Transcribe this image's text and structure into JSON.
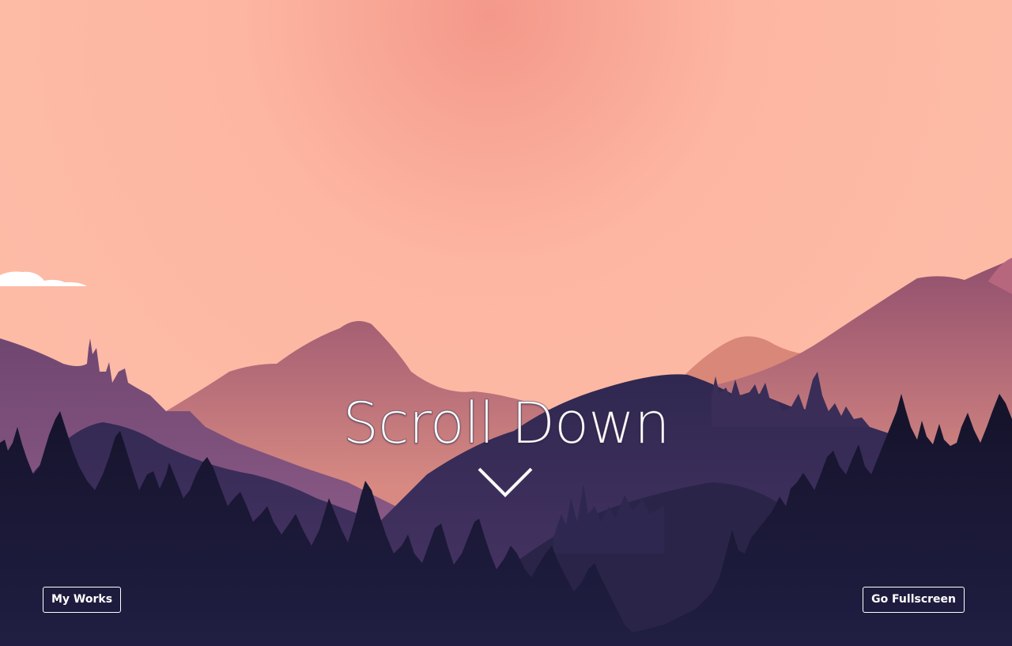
{
  "hero": {
    "title": "Scroll Down",
    "arrow_icon": "chevron-down-icon"
  },
  "buttons": {
    "my_works": "My Works",
    "fullscreen": "Go Fullscreen"
  },
  "colors": {
    "sky_top": "#f4988a",
    "sky_bottom": "#fdbba6",
    "far_mountains": "#a05a74",
    "mid_mountains": "#3d2f5c",
    "forest": "#1a1733",
    "button_border": "#ffffff",
    "text": "#ffffff"
  }
}
